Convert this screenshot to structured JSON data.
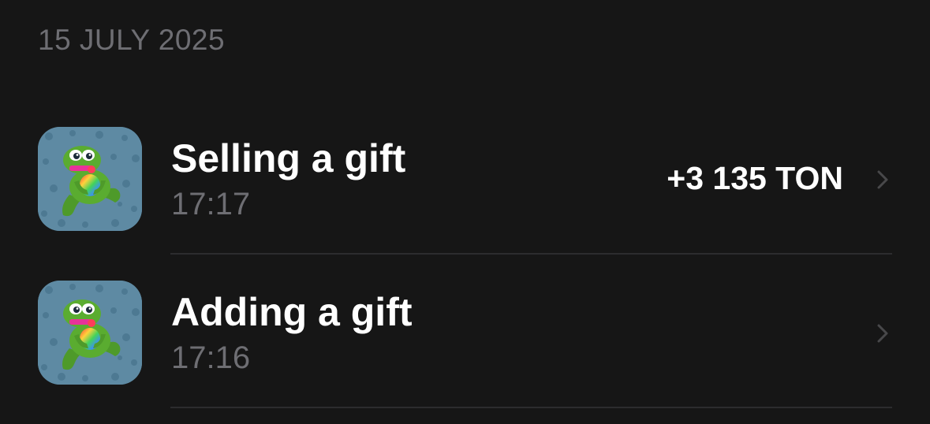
{
  "date_header": "15 JULY 2025",
  "transactions": [
    {
      "title": "Selling a gift",
      "time": "17:17",
      "amount": "+3 135 TON",
      "icon": "frog-gift-icon",
      "chevron_icon": "chevron-right-icon"
    },
    {
      "title": "Adding a gift",
      "time": "17:16",
      "amount": "",
      "icon": "frog-gift-icon",
      "chevron_icon": "chevron-right-icon"
    }
  ],
  "colors": {
    "background": "#161616",
    "primary_text": "#ffffff",
    "secondary_text": "#6e6e73",
    "divider": "#2c2c2e",
    "thumbnail_bg": "#5b87a0"
  }
}
